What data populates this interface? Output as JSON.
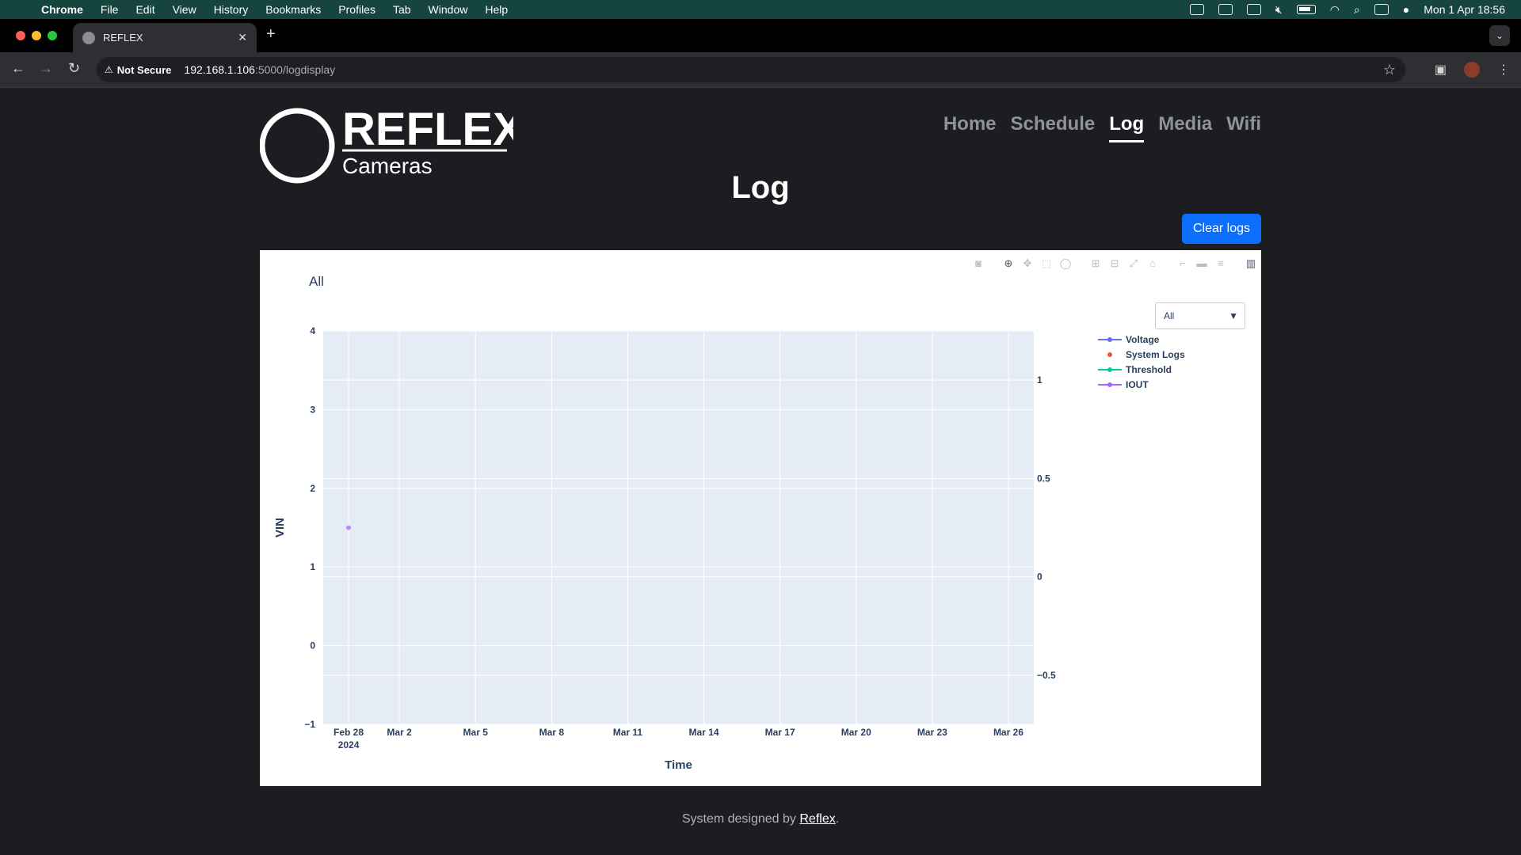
{
  "os_menubar": {
    "app": "Chrome",
    "items": [
      "File",
      "Edit",
      "View",
      "History",
      "Bookmarks",
      "Profiles",
      "Tab",
      "Window",
      "Help"
    ],
    "clock": "Mon 1 Apr  18:56"
  },
  "browser": {
    "tab_title": "REFLEX",
    "security_label": "Not Secure",
    "url_host": "192.168.1.106",
    "url_path": ":5000/logdisplay"
  },
  "site": {
    "logo_title": "REFLEX",
    "logo_subtitle": "Cameras",
    "nav": [
      {
        "label": "Home",
        "active": false
      },
      {
        "label": "Schedule",
        "active": false
      },
      {
        "label": "Log",
        "active": true
      },
      {
        "label": "Media",
        "active": false
      },
      {
        "label": "Wifi",
        "active": false
      }
    ],
    "page_heading": "Log",
    "clear_button": "Clear logs",
    "footer_prefix": "System designed by ",
    "footer_link": "Reflex",
    "footer_suffix": "."
  },
  "colors": {
    "primary_button": "#0d6efd",
    "plot_bg": "#e5ecf6",
    "voltage": "#636efa",
    "system_logs": "#ef553b",
    "threshold": "#00cc96",
    "iout": "#ab63fa"
  },
  "chart_data": {
    "type": "scatter",
    "title": "All",
    "xlabel": "Time",
    "ylabel": "VIN",
    "dropdown_selected": "All",
    "x_ticks": [
      "Feb 28",
      "Mar 2",
      "Mar 5",
      "Mar 8",
      "Mar 11",
      "Mar 14",
      "Mar 17",
      "Mar 20",
      "Mar 23",
      "Mar 26"
    ],
    "x_year_label": "2024",
    "x_range": [
      "2024-02-27",
      "2024-03-26"
    ],
    "ylim": [
      -1,
      4
    ],
    "y_ticks": [
      "−1",
      "0",
      "1",
      "2",
      "3",
      "4"
    ],
    "y2lim": [
      -0.75,
      1.25
    ],
    "y2_ticks": [
      "−0.5",
      "0",
      "0.5",
      "1"
    ],
    "grid": true,
    "legend_position": "top-right",
    "series": [
      {
        "name": "Voltage",
        "mode": "lines+markers",
        "points": []
      },
      {
        "name": "System Logs",
        "mode": "markers",
        "points": []
      },
      {
        "name": "Threshold",
        "mode": "lines+markers",
        "points": []
      },
      {
        "name": "IOUT",
        "mode": "lines+markers",
        "points": [
          {
            "x": "2024-02-28",
            "y": 1.5
          }
        ]
      }
    ]
  }
}
